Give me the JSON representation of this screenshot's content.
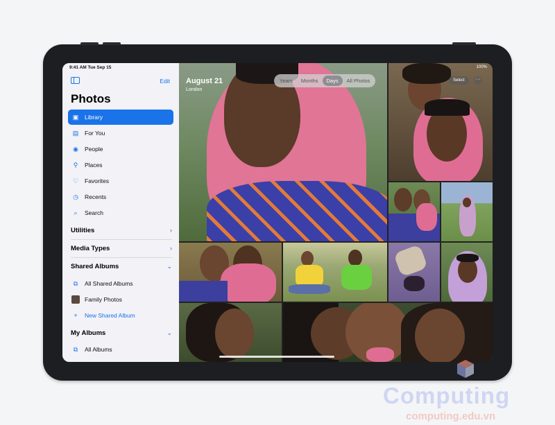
{
  "sidebar": {
    "status_time": "9:41 AM  Tue Sep 15",
    "edit_label": "Edit",
    "title": "Photos",
    "items": [
      {
        "label": "Library",
        "icon": "library-icon"
      },
      {
        "label": "For You",
        "icon": "for-you-icon"
      },
      {
        "label": "People",
        "icon": "people-icon"
      },
      {
        "label": "Places",
        "icon": "places-icon"
      },
      {
        "label": "Favorites",
        "icon": "heart-icon"
      },
      {
        "label": "Recents",
        "icon": "clock-icon"
      },
      {
        "label": "Search",
        "icon": "search-icon"
      }
    ],
    "utilities": "Utilities",
    "media_types": "Media Types",
    "shared_albums": "Shared Albums",
    "shared_items": [
      {
        "label": "All Shared Albums"
      },
      {
        "label": "Family Photos"
      },
      {
        "label": "New Shared Album"
      }
    ],
    "my_albums": "My Albums",
    "all_albums": "All Albums"
  },
  "main": {
    "date": "August 21",
    "location": "London",
    "tabs": [
      "Years",
      "Months",
      "Days",
      "All Photos"
    ],
    "active_tab": "Days",
    "select_label": "Select",
    "more_label": "···",
    "status_right": "100%"
  },
  "watermark": {
    "brand": "Computing",
    "site": "computing.edu.vn"
  },
  "colors": {
    "accent": "#1a73e8",
    "sidebar_bg": "#f2f2f7"
  }
}
